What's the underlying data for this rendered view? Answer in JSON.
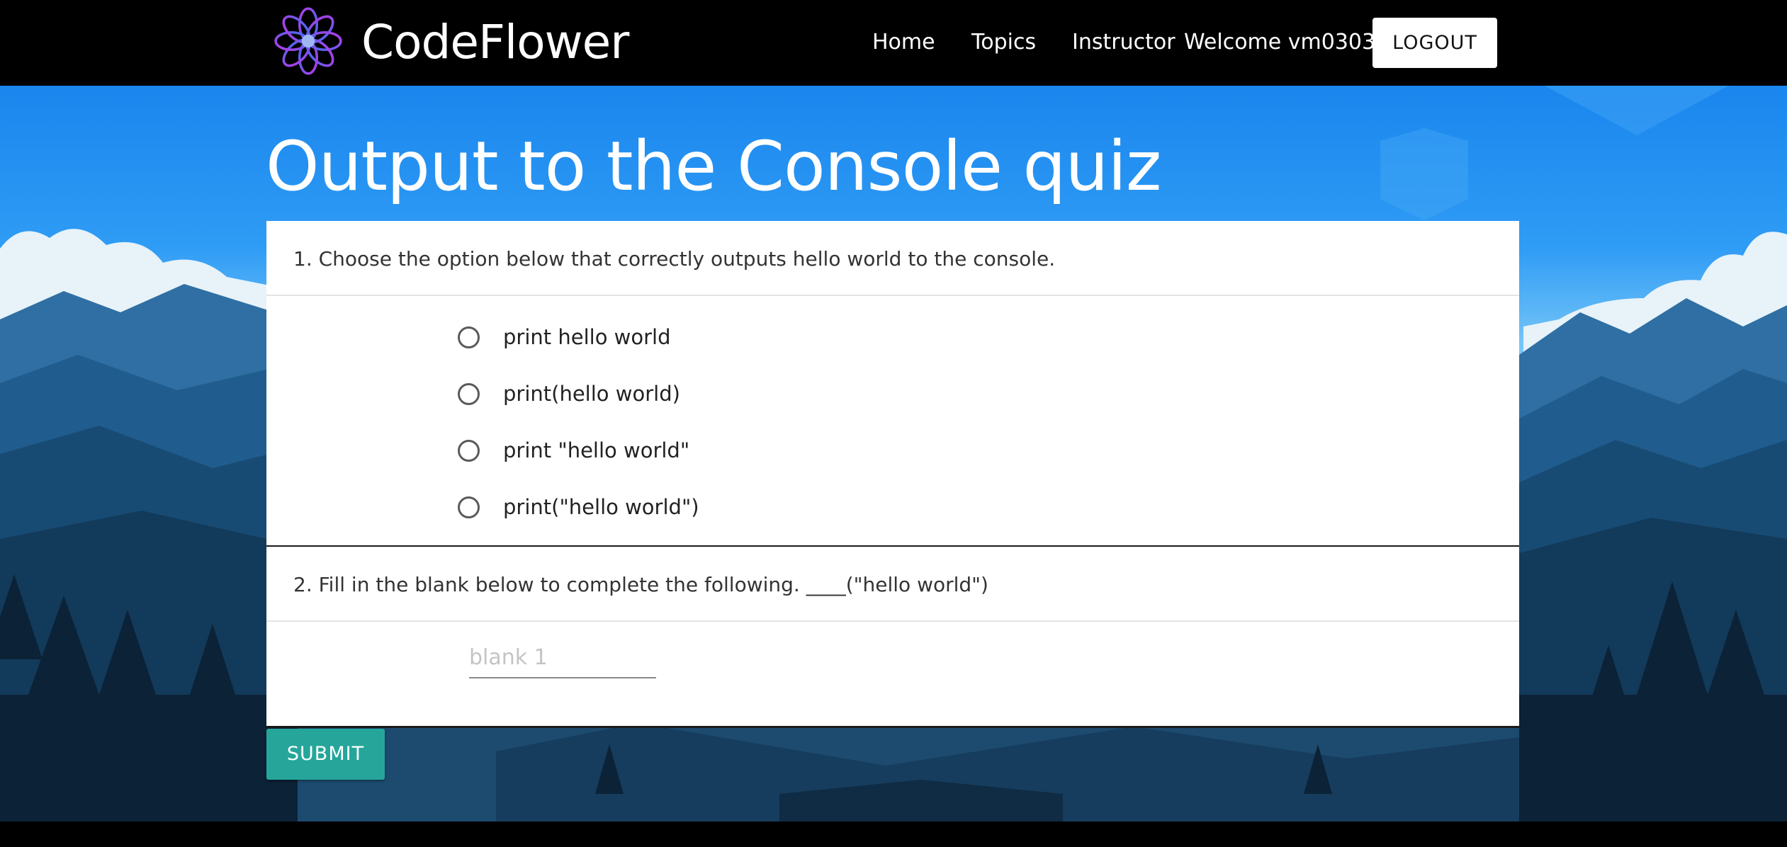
{
  "header": {
    "brand": "CodeFlower",
    "logo_icon": "flower-logo-icon",
    "nav": {
      "home": "Home",
      "topics": "Topics",
      "instructor": "Instructor"
    },
    "welcome": "Welcome vm0303",
    "logout_label": "LOGOUT"
  },
  "quiz": {
    "title": "Output to the Console quiz",
    "q1": {
      "text": "1. Choose the option below that correctly outputs hello world to the console.",
      "options": [
        "print hello world",
        "print(hello world)",
        "print \"hello world\"",
        "print(\"hello world\")"
      ]
    },
    "q2": {
      "text": "2. Fill in the blank below to complete the following. ____(\"hello world\")",
      "placeholder": "blank 1"
    },
    "submit_label": "SUBMIT"
  },
  "colors": {
    "header_bg": "#000000",
    "sky_top": "#1B8CF2",
    "submit": "#26A69A",
    "logo": "#8A3FE0"
  }
}
